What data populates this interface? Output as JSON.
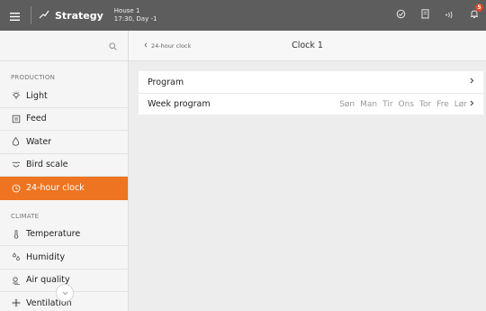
{
  "topbar": {
    "strategy_label": "Strategy",
    "house_name": "House 1",
    "house_time": "17:30, Day -1",
    "notification_count": "5"
  },
  "sidebar": {
    "groups": [
      {
        "label": "PRODUCTION",
        "items": [
          {
            "label": "Light",
            "icon": "bulb-icon"
          },
          {
            "label": "Feed",
            "icon": "feed-icon"
          },
          {
            "label": "Water",
            "icon": "water-drop-icon"
          },
          {
            "label": "Bird scale",
            "icon": "bird-scale-icon"
          },
          {
            "label": "24-hour clock",
            "icon": "clock-icon",
            "active": true
          }
        ]
      },
      {
        "label": "CLIMATE",
        "items": [
          {
            "label": "Temperature",
            "icon": "thermometer-icon"
          },
          {
            "label": "Humidity",
            "icon": "humidity-icon"
          },
          {
            "label": "Air quality",
            "icon": "air-quality-icon"
          },
          {
            "label": "Ventilation",
            "icon": "fan-icon"
          }
        ]
      }
    ]
  },
  "main": {
    "back_label": "24-hour clock",
    "title": "Clock 1",
    "rows": [
      {
        "label": "Program"
      },
      {
        "label": "Week program",
        "days": [
          "Søn",
          "Man",
          "Tir",
          "Ons",
          "Tor",
          "Fre",
          "Lør"
        ]
      }
    ]
  },
  "colors": {
    "accent": "#ee7421",
    "topbar": "#5d5d5d",
    "badge": "#e04a2a"
  }
}
